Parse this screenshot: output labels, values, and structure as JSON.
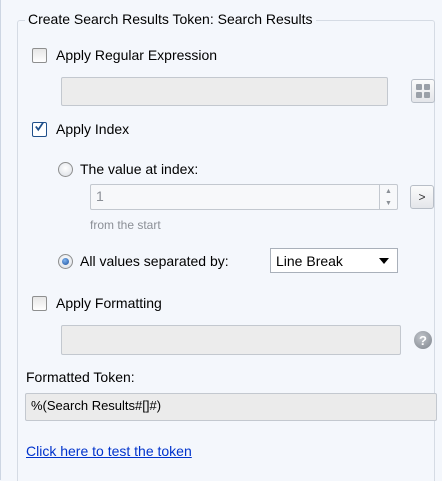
{
  "group": {
    "title": "Create Search Results Token: Search Results"
  },
  "regex": {
    "label": "Apply Regular Expression",
    "checked": false,
    "value": "",
    "button_icon": "grid-icon"
  },
  "index": {
    "label": "Apply Index",
    "checked": true,
    "value_at_index": {
      "label": "The value at index:",
      "selected": false,
      "value": "1",
      "go_label": ">",
      "from_text": "from the  start"
    },
    "all_values": {
      "label": "All values separated by:",
      "selected": true,
      "separator": "Line Break"
    }
  },
  "formatting": {
    "label": "Apply Formatting",
    "checked": false,
    "value": "",
    "help_label": "?"
  },
  "formatted_token": {
    "label": "Formatted Token:",
    "value": "%(Search Results#[]#)"
  },
  "test_link": "Click here to test the token",
  "colors": {
    "background": "#f4f7fc",
    "link": "#0033cc",
    "check_accent": "#1f4f8a"
  }
}
